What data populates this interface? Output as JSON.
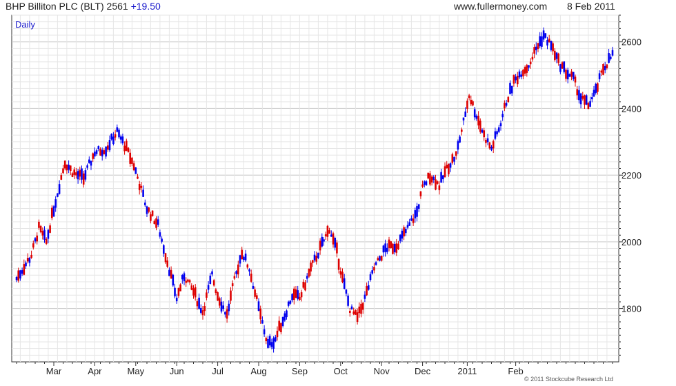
{
  "header": {
    "title": "BHP Billiton PLC (BLT) 2561",
    "change": "+19.50",
    "site": "www.fullermoney.com",
    "date": "8 Feb 2011"
  },
  "footer": {
    "copyright": "© 2011 Stockcube Research Ltd"
  },
  "chart_data": {
    "type": "candlestick",
    "period_label": "Daily",
    "ylim": [
      1640,
      2680
    ],
    "yticks": [
      1800,
      2000,
      2200,
      2400,
      2600
    ],
    "xlabels": [
      "Mar",
      "Apr",
      "May",
      "Jun",
      "Jul",
      "Aug",
      "Sep",
      "Oct",
      "Nov",
      "Dec",
      "2011",
      "Feb"
    ],
    "colors": {
      "up": "#0000ee",
      "down": "#dd0000",
      "grid": "#dddddd",
      "axis": "#333333"
    },
    "anchors": [
      [
        0,
        1890
      ],
      [
        8,
        1960
      ],
      [
        12,
        2040
      ],
      [
        16,
        2000
      ],
      [
        20,
        2100
      ],
      [
        26,
        2240
      ],
      [
        30,
        2210
      ],
      [
        36,
        2190
      ],
      [
        42,
        2270
      ],
      [
        48,
        2280
      ],
      [
        54,
        2330
      ],
      [
        58,
        2290
      ],
      [
        63,
        2230
      ],
      [
        70,
        2100
      ],
      [
        76,
        2050
      ],
      [
        81,
        1940
      ],
      [
        86,
        1830
      ],
      [
        90,
        1900
      ],
      [
        95,
        1850
      ],
      [
        100,
        1790
      ],
      [
        105,
        1900
      ],
      [
        108,
        1840
      ],
      [
        113,
        1780
      ],
      [
        116,
        1860
      ],
      [
        121,
        1970
      ],
      [
        125,
        1920
      ],
      [
        130,
        1800
      ],
      [
        135,
        1690
      ],
      [
        139,
        1710
      ],
      [
        144,
        1780
      ],
      [
        148,
        1840
      ],
      [
        152,
        1830
      ],
      [
        158,
        1920
      ],
      [
        163,
        1980
      ],
      [
        168,
        2040
      ],
      [
        172,
        1970
      ],
      [
        175,
        1890
      ],
      [
        179,
        1800
      ],
      [
        183,
        1770
      ],
      [
        187,
        1830
      ],
      [
        192,
        1920
      ],
      [
        198,
        1980
      ],
      [
        204,
        1990
      ],
      [
        210,
        2040
      ],
      [
        215,
        2090
      ],
      [
        218,
        2160
      ],
      [
        222,
        2200
      ],
      [
        227,
        2170
      ],
      [
        232,
        2230
      ],
      [
        236,
        2260
      ],
      [
        240,
        2360
      ],
      [
        243,
        2440
      ],
      [
        247,
        2380
      ],
      [
        251,
        2320
      ],
      [
        255,
        2280
      ],
      [
        259,
        2340
      ],
      [
        263,
        2420
      ],
      [
        267,
        2480
      ],
      [
        271,
        2510
      ],
      [
        275,
        2530
      ],
      [
        279,
        2580
      ],
      [
        283,
        2620
      ],
      [
        287,
        2590
      ],
      [
        291,
        2540
      ],
      [
        295,
        2510
      ],
      [
        299,
        2490
      ],
      [
        303,
        2430
      ],
      [
        307,
        2410
      ],
      [
        311,
        2450
      ],
      [
        315,
        2520
      ],
      [
        320,
        2561
      ]
    ]
  }
}
